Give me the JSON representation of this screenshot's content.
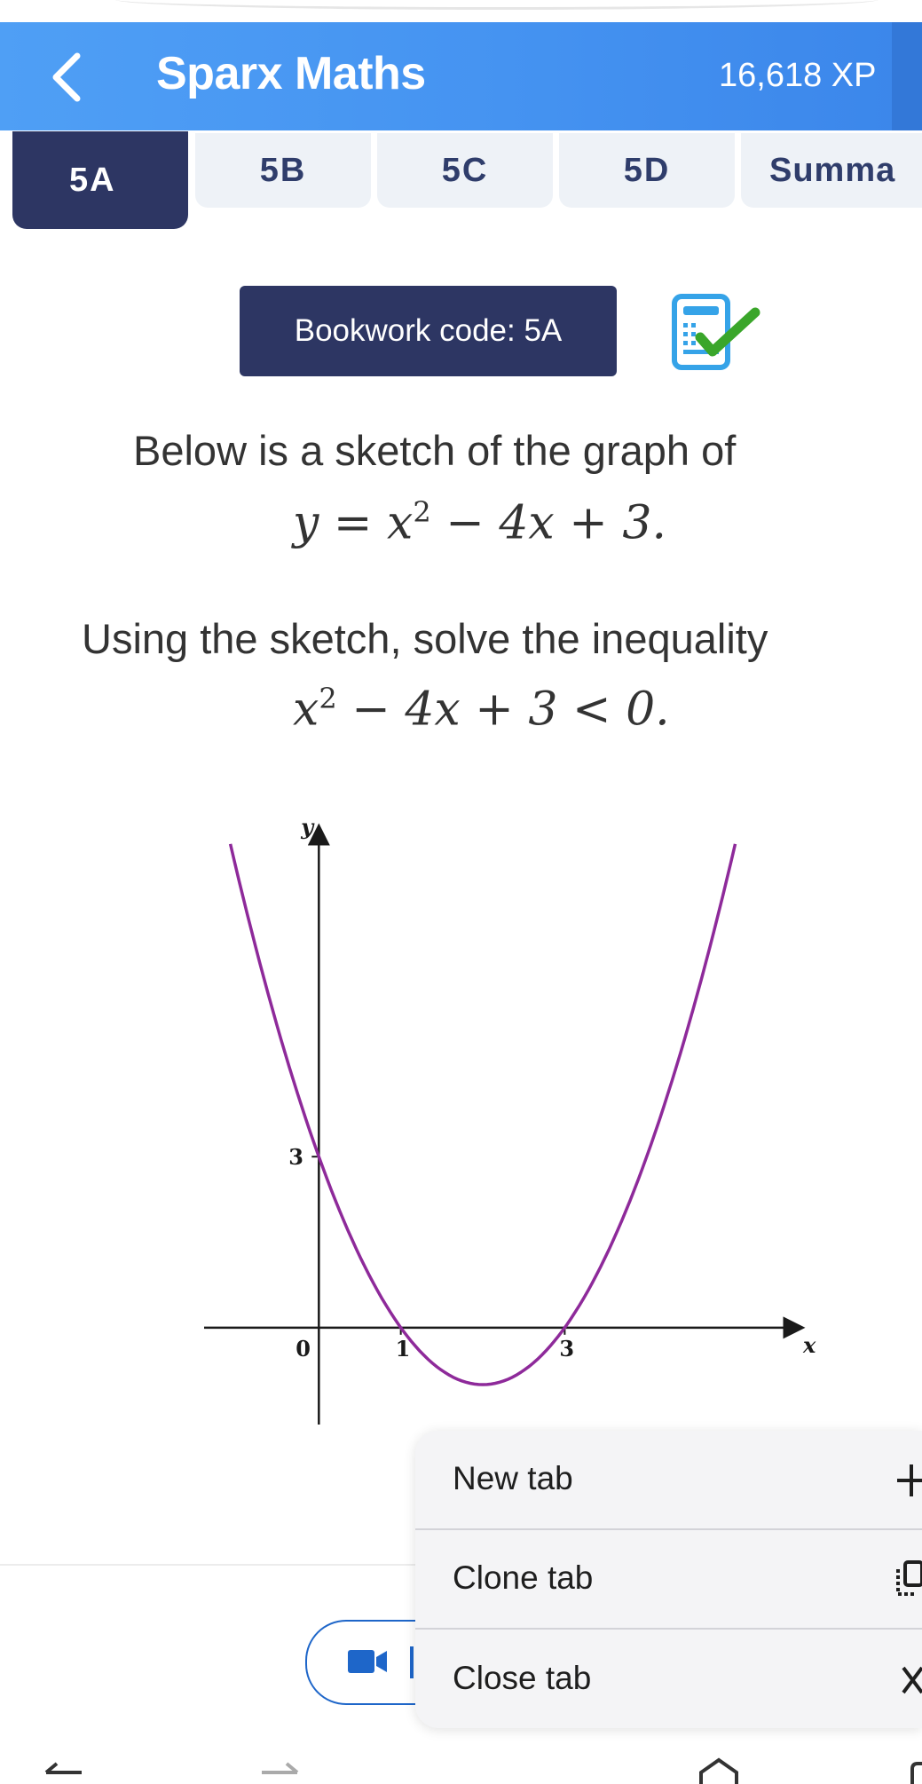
{
  "header": {
    "app_title": "Sparx Maths",
    "xp": "16,618 XP",
    "accent_color": "#4593f1",
    "back_icon": "chevron-left-icon"
  },
  "tabs": [
    {
      "label": "5A",
      "active": true
    },
    {
      "label": "5B",
      "active": false
    },
    {
      "label": "5C",
      "active": false
    },
    {
      "label": "5D",
      "active": false
    },
    {
      "label": "Summa",
      "active": false
    }
  ],
  "bookwork": {
    "label": "Bookwork code: 5A",
    "icon": "calculator-check-icon"
  },
  "question": {
    "line1": "Below is a sketch of the graph of",
    "equation_lhs": "y",
    "equation_rhs_a": "x",
    "equation_rhs_exp": "2",
    "equation_rhs_b": " − 4x + 3.",
    "line2": "Using the sketch, solve the inequality",
    "ineq_a": "x",
    "ineq_exp": "2",
    "ineq_b": " − 4x + 3 < 0."
  },
  "chart_data": {
    "type": "line",
    "title": "",
    "xlabel": "x",
    "ylabel": "y",
    "function": "y = x^2 - 4x + 3",
    "x": [
      -1.08,
      -0.5,
      0,
      0.5,
      1,
      1.5,
      2,
      2.5,
      3,
      3.5,
      4,
      4.5,
      5.08
    ],
    "y": [
      8.49,
      5.25,
      3,
      1.25,
      0,
      -0.75,
      -1,
      -0.75,
      0,
      1.25,
      3,
      5.25,
      8.49
    ],
    "xlim": [
      -1.4,
      5.8
    ],
    "ylim": [
      -1.7,
      8.5
    ],
    "ytick_labels": [
      "3"
    ],
    "xtick_labels": [
      "0",
      "1",
      "3"
    ],
    "line_color": "#8e2a9a",
    "grid": false
  },
  "menu": {
    "items": [
      {
        "label": "New tab",
        "icon": "plus-icon"
      },
      {
        "label": "Clone tab",
        "icon": "clone-icon"
      },
      {
        "label": "Close tab",
        "icon": "close-icon"
      }
    ]
  },
  "nav": {
    "back_icon": "arrow-left-icon",
    "forward_icon": "arrow-right-icon",
    "home_icon": "home-icon"
  }
}
